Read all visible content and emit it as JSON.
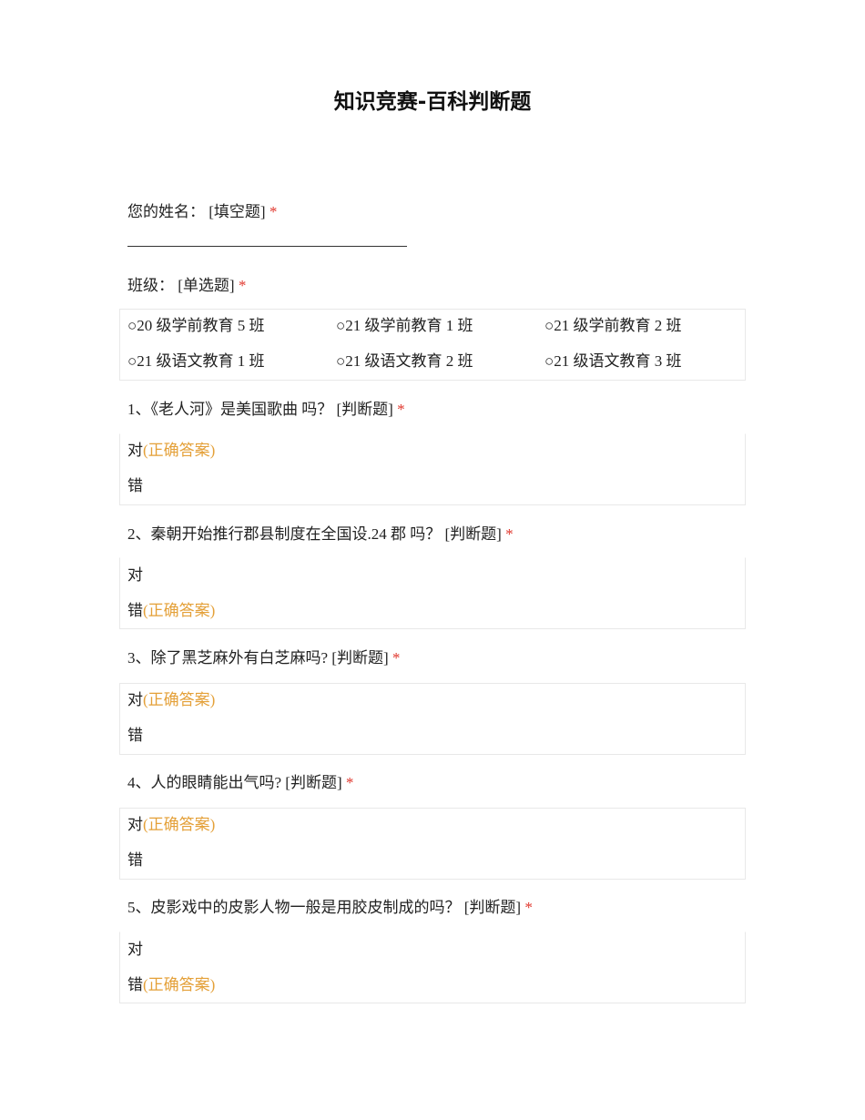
{
  "title": "知识竞赛-百科判断题",
  "required_mark": "*",
  "name_question": {
    "label": "您的姓名：",
    "type": "[填空题]"
  },
  "class_question": {
    "label": "班级：",
    "type": "[单选题]",
    "options": [
      "○20 级学前教育 5 班",
      "○21 级学前教育 1 班",
      "○21 级学前教育 2 班",
      "○21 级语文教育 1 班",
      "○21 级语文教育 2 班",
      "○21 级语文教育 3 班"
    ]
  },
  "correct_tag": "(正确答案)",
  "questions": [
    {
      "text": "1、《老人河》是美国歌曲 吗？",
      "type": "[判断题]",
      "options": [
        "对",
        "错"
      ],
      "correct": 0
    },
    {
      "text": "2、秦朝开始推行郡县制度在全国设.24 郡 吗？",
      "type": "[判断题]",
      "options": [
        "对",
        "错"
      ],
      "correct": 1
    },
    {
      "text": "3、除了黑芝麻外有白芝麻吗?",
      "type": "[判断题]",
      "options": [
        "对",
        "错"
      ],
      "correct": 0
    },
    {
      "text": "4、人的眼睛能出气吗?",
      "type": "[判断题]",
      "options": [
        "对",
        "错"
      ],
      "correct": 0
    },
    {
      "text": "5、皮影戏中的皮影人物一般是用胶皮制成的吗？",
      "type": "[判断题]",
      "options": [
        "对",
        "错"
      ],
      "correct": 1
    }
  ]
}
